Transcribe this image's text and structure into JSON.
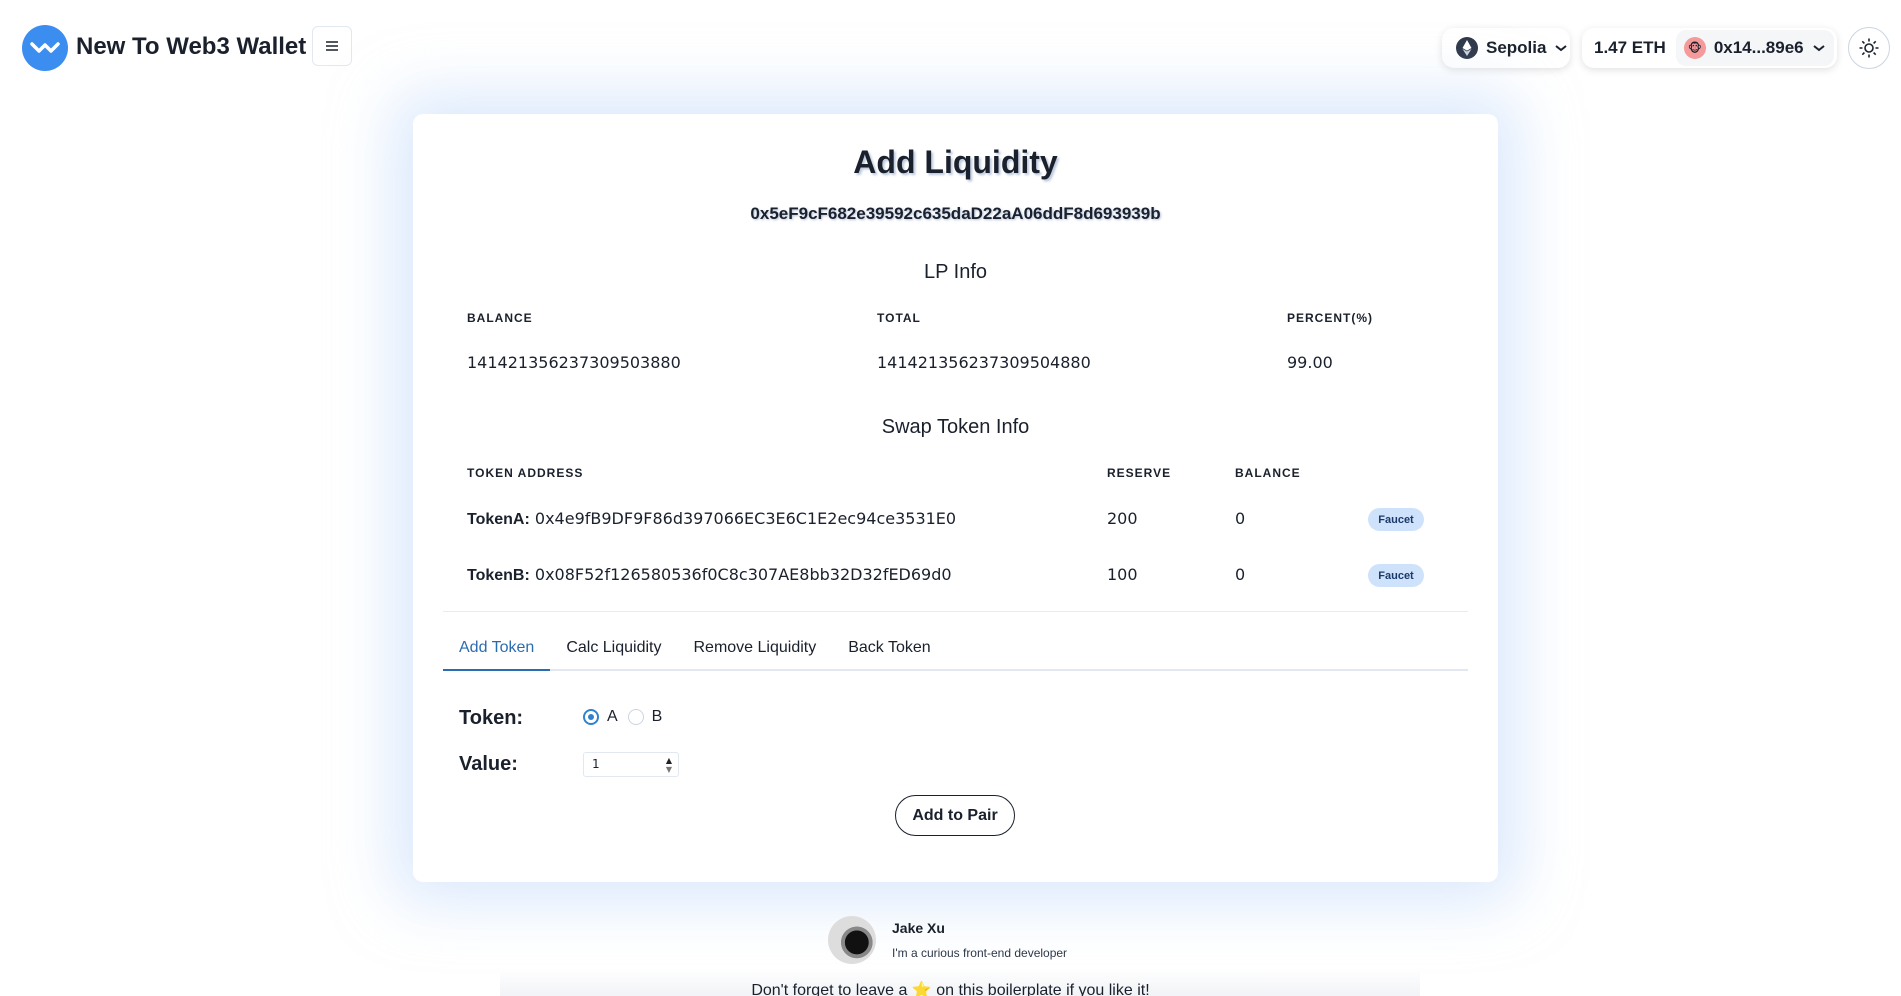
{
  "header": {
    "app_title": "New To Web3 Wallet",
    "network": "Sepolia",
    "balance": "1.47 ETH",
    "account": "0x14...89e6"
  },
  "card": {
    "title": "Add Liquidity",
    "address": "0x5eF9cF682e39592c635daD22aA06ddF8d693939b",
    "lp_info": {
      "title": "LP Info",
      "headers": [
        "BALANCE",
        "TOTAL",
        "PERCENT(%)"
      ],
      "values": [
        "141421356237309503880",
        "141421356237309504880",
        "99.00"
      ]
    },
    "swap_info": {
      "title": "Swap Token Info",
      "headers": [
        "TOKEN ADDRESS",
        "RESERVE",
        "BALANCE"
      ],
      "rows": [
        {
          "label": "TokenA:",
          "address": "0x4e9fB9DF9F86d397066EC3E6C1E2ec94ce3531E0",
          "reserve": "200",
          "balance": "0",
          "action": "Faucet"
        },
        {
          "label": "TokenB:",
          "address": "0x08F52f126580536f0C8c307AE8bb32D32fED69d0",
          "reserve": "100",
          "balance": "0",
          "action": "Faucet"
        }
      ]
    },
    "tabs": [
      "Add Token",
      "Calc Liquidity",
      "Remove Liquidity",
      "Back Token"
    ],
    "form": {
      "token_label": "Token:",
      "option_a": "A",
      "option_b": "B",
      "selected": "A",
      "value_label": "Value:",
      "value": "1",
      "submit_label": "Add to Pair"
    }
  },
  "footer": {
    "author_name": "Jake Xu",
    "author_bio": "I'm a curious front-end developer",
    "note_before": "Don't forget to leave a",
    "note_star": "⭐",
    "note_after": "on this boilerplate if you like it!"
  },
  "colors": {
    "accent": "#3182ce",
    "logo": "#3b8ef0",
    "faucet_badge": "#cfe2fb"
  }
}
